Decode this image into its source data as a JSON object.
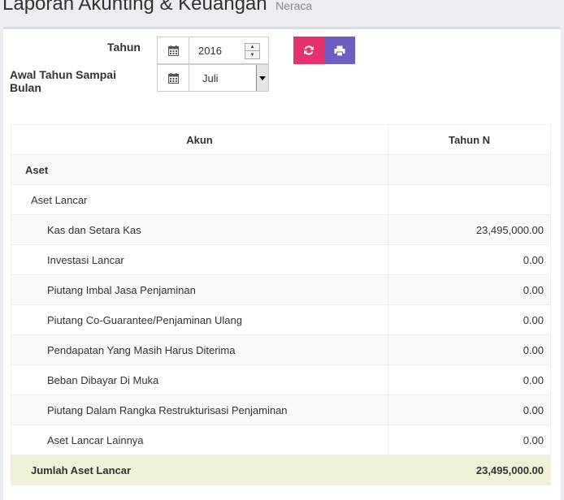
{
  "header": {
    "title": "Laporan Akunting & Keuangan",
    "subtitle": "Neraca"
  },
  "filters": {
    "year_label": "Tahun",
    "year_value": "2016",
    "month_label": "Awal Tahun Sampai Bulan",
    "month_value": "Juli"
  },
  "icons": {
    "calendar": "calendar-icon",
    "refresh": "refresh-icon",
    "print": "print-icon"
  },
  "colors": {
    "refresh_button": "#e6316f",
    "print_button": "#6e5ec2",
    "total_row": "#f0f0d8"
  },
  "table": {
    "headers": [
      "Akun",
      "Tahun N"
    ],
    "rows": [
      {
        "label": "Aset",
        "value": "",
        "level": 0
      },
      {
        "label": "Aset Lancar",
        "value": "",
        "level": 1
      },
      {
        "label": "Kas dan Setara Kas",
        "value": "23,495,000.00",
        "level": 2
      },
      {
        "label": "Investasi Lancar",
        "value": "0.00",
        "level": 2
      },
      {
        "label": "Piutang Imbal Jasa Penjaminan",
        "value": "0.00",
        "level": 2
      },
      {
        "label": "Piutang Co-Guarantee/Penjaminan Ulang",
        "value": "0.00",
        "level": 2
      },
      {
        "label": "Pendapatan Yang Masih Harus Diterima",
        "value": "0.00",
        "level": 2
      },
      {
        "label": "Beban Dibayar Di Muka",
        "value": "0.00",
        "level": 2
      },
      {
        "label": "Piutang Dalam Rangka Restrukturisasi Penjaminan",
        "value": "0.00",
        "level": 2
      },
      {
        "label": "Aset Lancar Lainnya",
        "value": "0.00",
        "level": 2
      },
      {
        "label": "Jumlah Aset Lancar",
        "value": "23,495,000.00",
        "level": 1,
        "total": true
      }
    ]
  }
}
